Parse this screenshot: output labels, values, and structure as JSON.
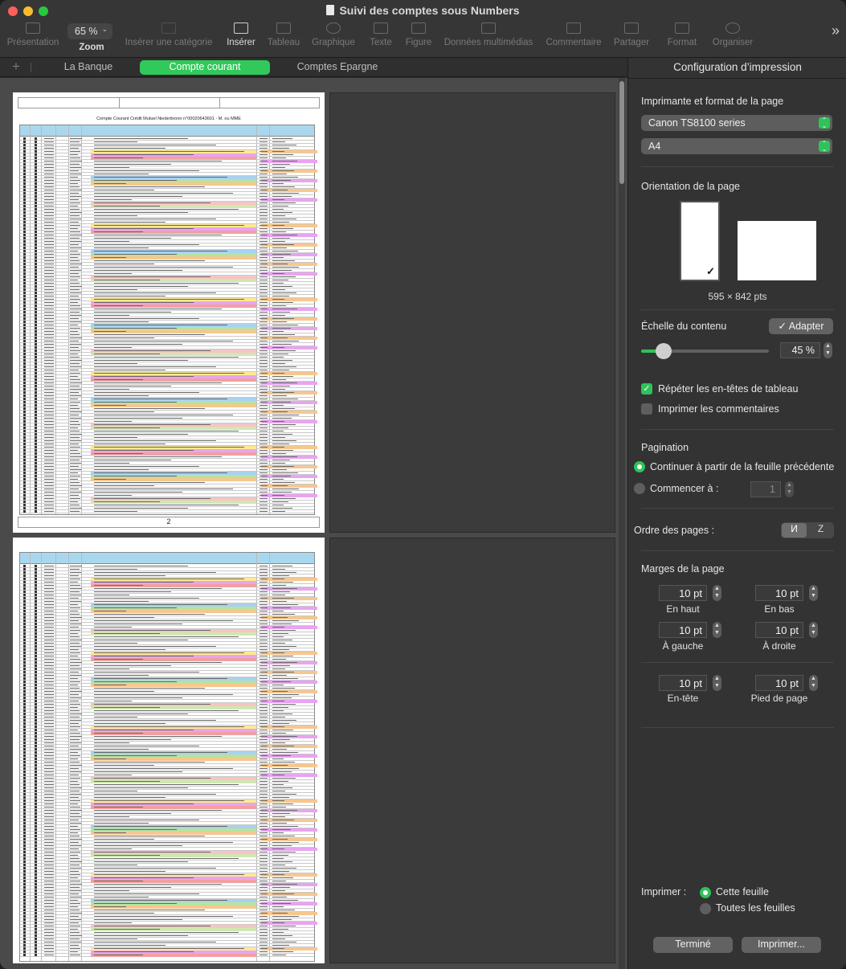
{
  "window": {
    "title": "Suivi des comptes sous Numbers"
  },
  "toolbar": {
    "presentation": "Présentation",
    "zoom_value": "65 %",
    "zoom_label": "Zoom",
    "insert_category": "Insérer une catégorie",
    "insert": "Insérer",
    "table": "Tableau",
    "chart": "Graphique",
    "text": "Texte",
    "shape": "Figure",
    "media": "Données multimédias",
    "comment": "Commentaire",
    "share": "Partager",
    "format": "Format",
    "organize": "Organiser"
  },
  "sheets": {
    "tabs": [
      "La Banque",
      "Compte courant",
      "Comptes Epargne"
    ],
    "selected": "Compte courant"
  },
  "preview": {
    "report_title": "Compte Courant Crédit Mutuel Niederbronn n°00020643601 - M. ou MME",
    "page_number": "2"
  },
  "panel": {
    "title": "Configuration d’impression",
    "printer_section": "Imprimante et format de la page",
    "printer": "Canon TS8100 series",
    "paper": "A4",
    "orientation_section": "Orientation de la page",
    "page_size": "595 × 842 pts",
    "scale_section": "Échelle du contenu",
    "fit_button": "✓ Adapter",
    "scale_value": "45 %",
    "scale_percent": 45,
    "repeat_headers": "Répéter les en-têtes de tableau",
    "print_comments": "Imprimer les commentaires",
    "pagination_section": "Pagination",
    "continue_from_prev": "Continuer à partir de la feuille précédente",
    "start_at": "Commencer à :",
    "start_value": "1",
    "page_order": "Ordre des pages :",
    "margins_section": "Marges de la page",
    "margin_top": "10 pt",
    "margin_top_label": "En haut",
    "margin_bottom": "10 pt",
    "margin_bottom_label": "En bas",
    "margin_left": "10 pt",
    "margin_left_label": "À gauche",
    "margin_right": "10 pt",
    "margin_right_label": "À droite",
    "header": "10 pt",
    "header_label": "En-tête",
    "footer": "10 pt",
    "footer_label": "Pied de page",
    "print_label": "Imprimer :",
    "this_sheet": "Cette feuille",
    "all_sheets": "Toutes les feuilles",
    "done_button": "Terminé",
    "print_button": "Imprimer..."
  }
}
